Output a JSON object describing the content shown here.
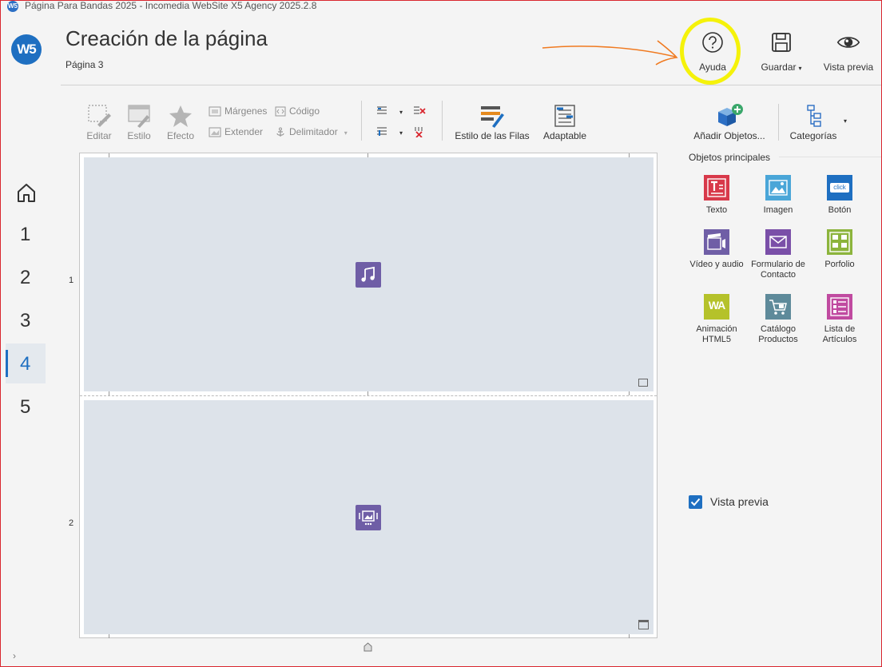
{
  "window": {
    "title": "Página Para Bandas 2025 - Incomedia WebSite X5 Agency 2025.2.8"
  },
  "logo": {
    "text": "W5"
  },
  "header": {
    "title": "Creación de la página",
    "subtitle": "Página 3",
    "help_label": "Ayuda",
    "save_label": "Guardar",
    "preview_label": "Vista previa"
  },
  "nav": {
    "pages": [
      "1",
      "2",
      "3",
      "4",
      "5"
    ],
    "active_page": "4"
  },
  "toolbar": {
    "edit": "Editar",
    "style": "Estilo",
    "effect": "Efecto",
    "margins": "Márgenes",
    "extend": "Extender",
    "code": "Código",
    "delimiter": "Delimitador",
    "row_style": "Estilo de las Filas",
    "adaptable": "Adaptable",
    "add_objects": "Añadir Objetos...",
    "categories": "Categorías"
  },
  "canvas": {
    "rows": [
      {
        "number": "1",
        "icon": "music-note-icon"
      },
      {
        "number": "2",
        "icon": "gallery-icon"
      }
    ]
  },
  "panel": {
    "section_title": "Objetos principales",
    "objects": [
      {
        "label": "Texto",
        "icon": "text-object-icon",
        "color": "#d8394a"
      },
      {
        "label": "Imagen",
        "icon": "image-object-icon",
        "color": "#4aa6d8"
      },
      {
        "label": "Botón",
        "icon": "button-object-icon",
        "color": "#1e6fc1",
        "badge": "click"
      },
      {
        "label": "Vídeo y audio",
        "icon": "video-audio-object-icon",
        "color": "#6f5ea6"
      },
      {
        "label": "Formulario de  Contacto",
        "icon": "contact-form-object-icon",
        "color": "#7a4fa8"
      },
      {
        "label": "Porfolio",
        "icon": "portfolio-object-icon",
        "color": "#8cb43c"
      },
      {
        "label": "Animación HTML5",
        "icon": "html5-animation-object-icon",
        "color": "#b5c22a",
        "badge": "WA"
      },
      {
        "label": "Catálogo Productos",
        "icon": "product-catalog-object-icon",
        "color": "#5e8a9a"
      },
      {
        "label": "Lista de Artículos",
        "icon": "article-list-object-icon",
        "color": "#c04aa0"
      }
    ],
    "preview_checkbox_label": "Vista previa",
    "preview_checked": true
  },
  "colors": {
    "accent": "#1e6fc1",
    "row_background": "#dde3ea",
    "object_icon": "#6f5ea6",
    "highlight": "#f5f20a",
    "annotation_arrow": "#f07a20"
  }
}
